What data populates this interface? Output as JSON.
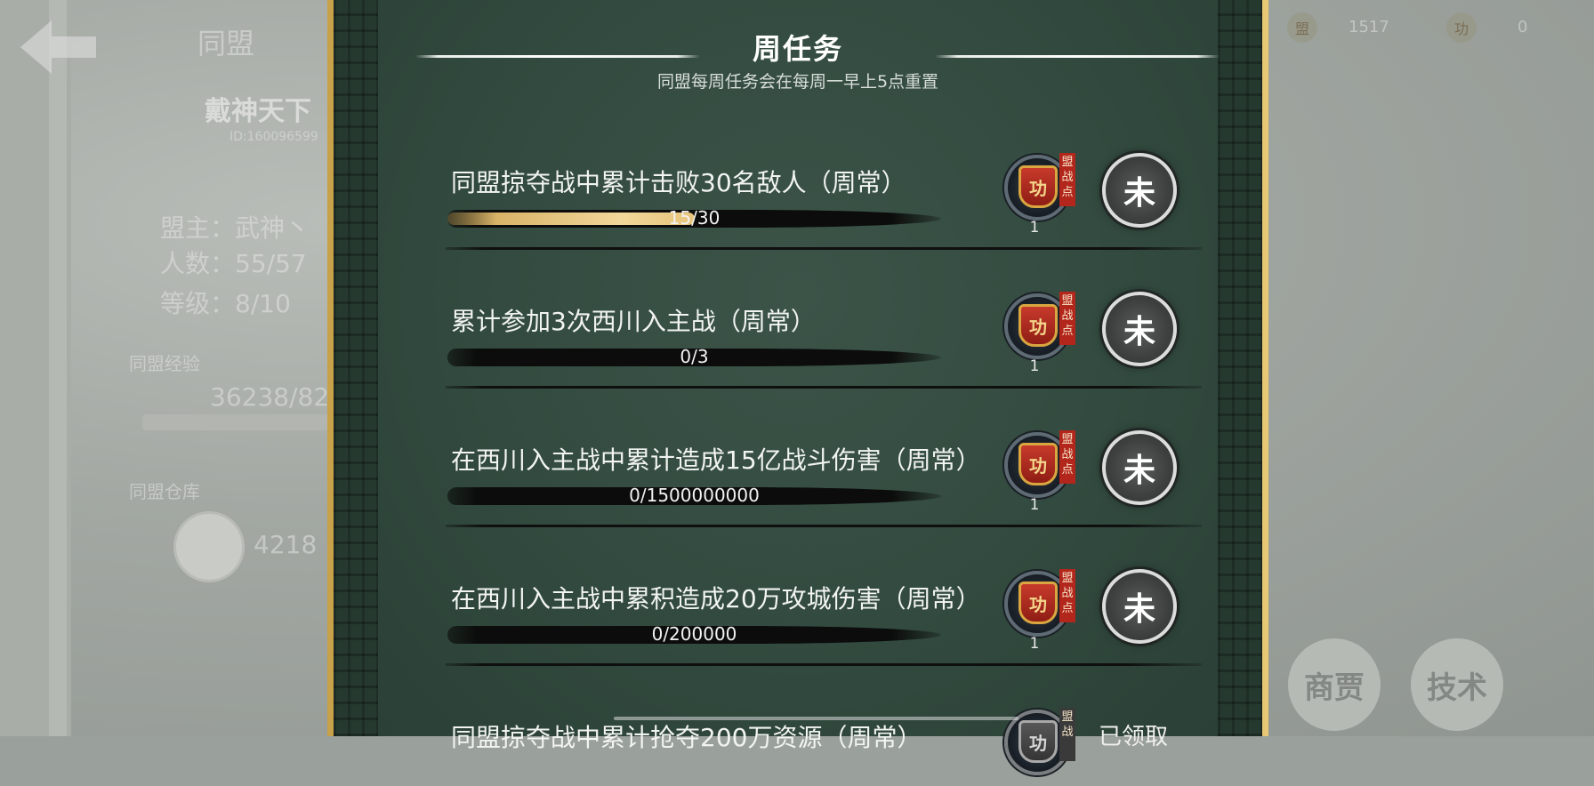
{
  "background": {
    "alliance_tab": "同盟",
    "alliance_name": "戴神天下",
    "alliance_id": "ID:160096599",
    "leader": "盟主：武神丶",
    "members": "人数：55/57",
    "level": "等级：8/10",
    "exp_label": "同盟经验",
    "exp_value": "36238/82",
    "storage_label": "同盟仓库",
    "storage_value": "4218",
    "currency1": "1517",
    "currency2": "0",
    "btn_merchant": "商贾",
    "btn_tech": "技术"
  },
  "panel": {
    "title": "周任务",
    "subtitle": "同盟每周任务会在每周一早上5点重置"
  },
  "tasks": [
    {
      "name": "同盟掠夺战中累计击败30名敌人（周常）",
      "progress_text": "15/30",
      "progress": 0.5,
      "reward_icon": "功",
      "reward_tag": "盟战点",
      "reward_count": "1",
      "status": "未"
    },
    {
      "name": "累计参加3次西川入主战（周常）",
      "progress_text": "0/3",
      "progress": 0,
      "reward_icon": "功",
      "reward_tag": "盟战点",
      "reward_count": "1",
      "status": "未"
    },
    {
      "name": "在西川入主战中累计造成15亿战斗伤害（周常）",
      "progress_text": "0/1500000000",
      "progress": 0,
      "reward_icon": "功",
      "reward_tag": "盟战点",
      "reward_count": "1",
      "status": "未"
    },
    {
      "name": "在西川入主战中累积造成20万攻城伤害（周常）",
      "progress_text": "0/200000",
      "progress": 0,
      "reward_icon": "功",
      "reward_tag": "盟战点",
      "reward_count": "1",
      "status": "未"
    },
    {
      "name": "同盟掠夺战中累计抢夺200万资源（周常）",
      "reward_icon": "功",
      "reward_tag": "盟战",
      "status_text": "已领取"
    }
  ]
}
